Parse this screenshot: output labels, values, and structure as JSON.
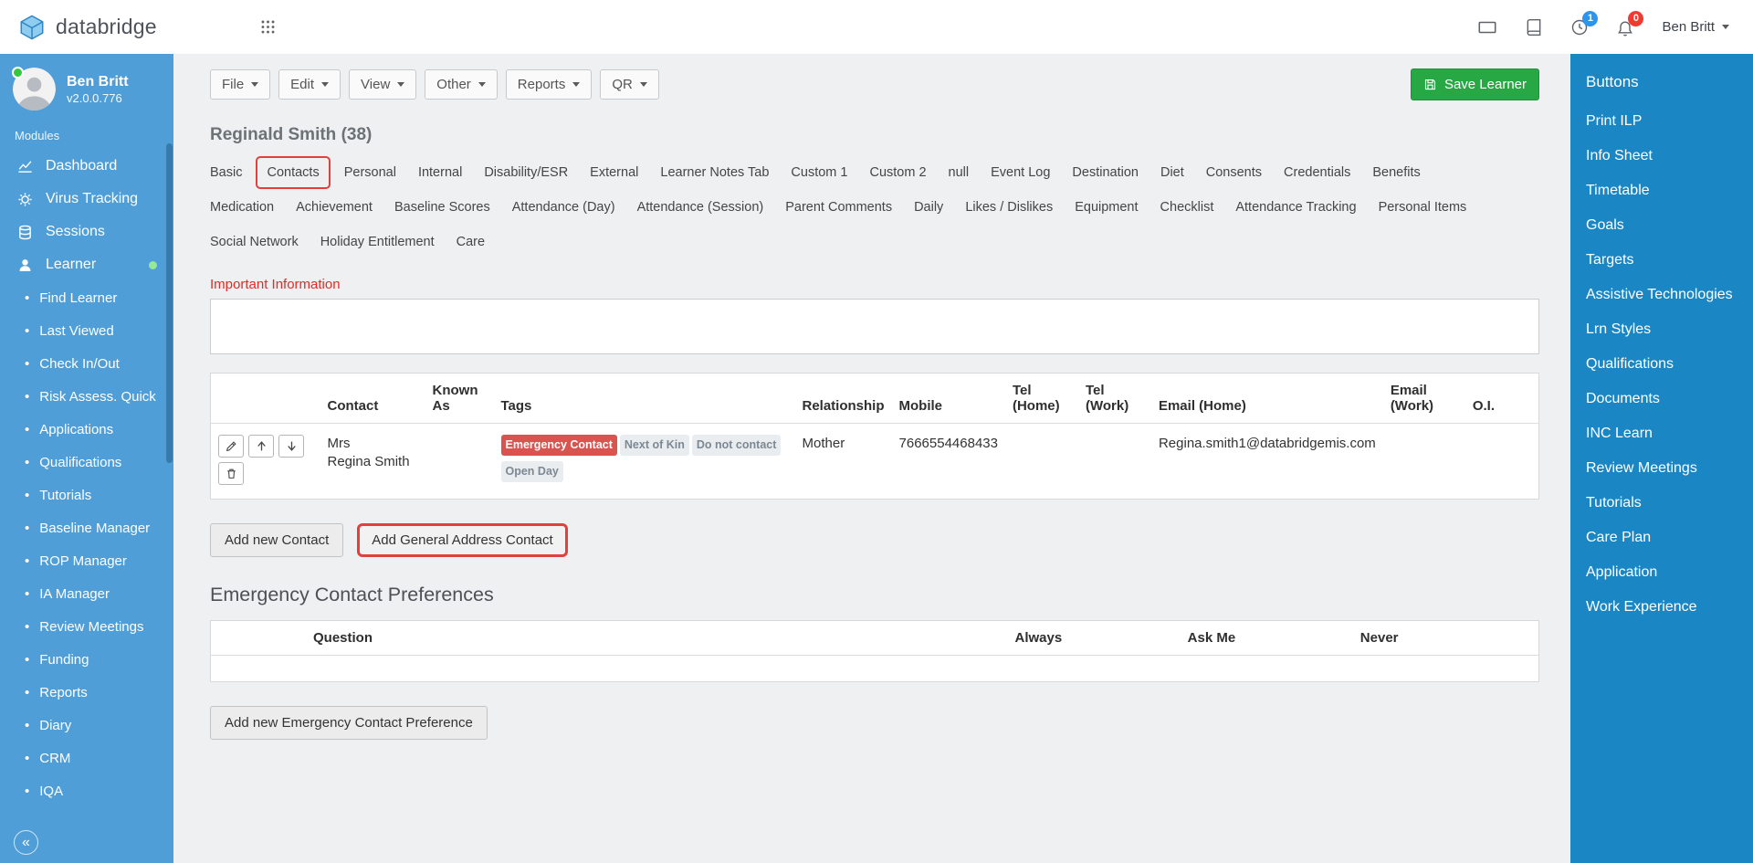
{
  "colors": {
    "brand_blue": "#4f9ed8",
    "panel_blue": "#1a86c4",
    "save_green": "#28a745",
    "accent_red": "#e2403c",
    "badge_red": "#d9534f"
  },
  "header": {
    "brand": "databridge",
    "icons": [
      "apps-grid-icon",
      "display-icon",
      "book-icon",
      "clock-icon",
      "bell-icon"
    ],
    "clock_badge": "1",
    "bell_badge": "0",
    "user_menu": "Ben Britt"
  },
  "sidebar": {
    "user": {
      "name": "Ben Britt",
      "version": "v2.0.0.776"
    },
    "section_label": "Modules",
    "modules": [
      {
        "label": "Dashboard",
        "icon": "chart-line-icon"
      },
      {
        "label": "Virus Tracking",
        "icon": "virus-icon"
      },
      {
        "label": "Sessions",
        "icon": "sessions-icon"
      },
      {
        "label": "Learner",
        "icon": "learner-icon",
        "active": true
      }
    ],
    "items": [
      "Find Learner",
      "Last Viewed",
      "Check In/Out",
      "Risk Assess. Quick",
      "Applications",
      "Qualifications",
      "Tutorials",
      "Baseline Manager",
      "ROP Manager",
      "IA Manager",
      "Review Meetings",
      "Funding",
      "Reports",
      "Diary",
      "CRM",
      "IQA"
    ],
    "collapse_glyph": "«"
  },
  "toolbar": {
    "menus": [
      "File",
      "Edit",
      "View",
      "Other",
      "Reports",
      "QR"
    ],
    "save_label": "Save Learner"
  },
  "page": {
    "title": "Reginald Smith (38)",
    "active_tab": "Contacts",
    "tabs_row1": [
      "Basic",
      "Contacts",
      "Personal",
      "Internal",
      "Disability/ESR",
      "External",
      "Learner Notes Tab",
      "Custom 1",
      "Custom 2",
      "null",
      "Event Log",
      "Destination",
      "Diet",
      "Consents",
      "Credentials",
      "Benefits"
    ],
    "tabs_row2": [
      "Medication",
      "Achievement",
      "Baseline Scores",
      "Attendance (Day)",
      "Attendance (Session)",
      "Parent Comments",
      "Daily",
      "Likes / Dislikes",
      "Equipment",
      "Checklist",
      "Attendance Tracking",
      "Personal Items"
    ],
    "tabs_row3": [
      "Social Network",
      "Holiday Entitlement",
      "Care"
    ],
    "important_info_label": "Important Information",
    "important_info_value": ""
  },
  "contacts_table": {
    "headers": [
      "",
      "Contact",
      "Known As",
      "Tags",
      "Relationship",
      "Mobile",
      "Tel (Home)",
      "Tel (Work)",
      "Email (Home)",
      "Email (Work)",
      "O.I."
    ],
    "row": {
      "actions": [
        {
          "name": "edit-contact",
          "icon": "edit-icon"
        },
        {
          "name": "move-contact-up",
          "icon": "arrow-up-icon"
        },
        {
          "name": "move-contact-down",
          "icon": "arrow-down-icon"
        },
        {
          "name": "delete-contact",
          "icon": "trash-icon"
        }
      ],
      "title": "Mrs",
      "name": "Regina Smith",
      "known_as": "",
      "tags": [
        {
          "label": "Emergency Contact",
          "type": "danger"
        },
        {
          "label": "Next of Kin",
          "type": "default"
        },
        {
          "label": "Do not contact",
          "type": "default"
        },
        {
          "label": "Open Day",
          "type": "default"
        }
      ],
      "relationship": "Mother",
      "mobile": "7666554468433",
      "tel_home": "",
      "tel_work": "",
      "email_home": "Regina.smith1@databridgemis.com",
      "email_work": "",
      "oi": ""
    },
    "add_contact_label": "Add new Contact",
    "add_general_label": "Add General Address Contact"
  },
  "preferences": {
    "heading": "Emergency Contact Preferences",
    "headers": [
      "Question",
      "Always",
      "Ask Me",
      "Never"
    ],
    "rows": [],
    "add_label": "Add new Emergency Contact Preference"
  },
  "buttons_panel": {
    "title": "Buttons",
    "items": [
      "Print ILP",
      "Info Sheet",
      "Timetable",
      "Goals",
      "Targets",
      "Assistive Technologies",
      "Lrn Styles",
      "Qualifications",
      "Documents",
      "INC Learn",
      "Review Meetings",
      "Tutorials",
      "Care Plan",
      "Application",
      "Work Experience"
    ]
  }
}
